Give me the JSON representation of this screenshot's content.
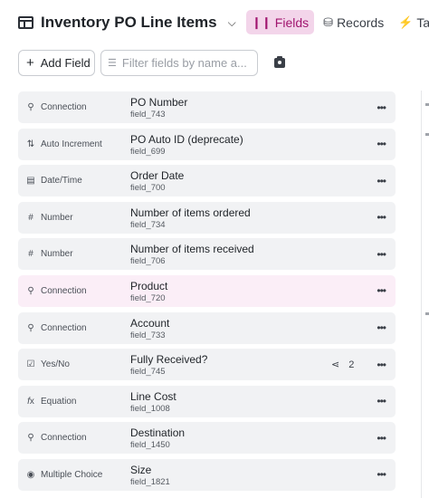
{
  "header": {
    "title": "Inventory PO Line Items",
    "tabs": [
      {
        "label": "Fields",
        "icon": "bars-icon",
        "active": true
      },
      {
        "label": "Records",
        "icon": "database-icon",
        "active": false
      },
      {
        "label": "Tasks",
        "icon": "bolt-icon",
        "active": false
      }
    ]
  },
  "toolbar": {
    "add_field_label": "Add Field",
    "filter_placeholder": "Filter fields by name a..."
  },
  "fields": [
    {
      "type": "Connection",
      "icon": "connection-icon",
      "name": "PO Number",
      "key": "field_743"
    },
    {
      "type": "Auto Increment",
      "icon": "auto-increment-icon",
      "name": "PO Auto ID (deprecate)",
      "key": "field_699"
    },
    {
      "type": "Date/Time",
      "icon": "calendar-icon",
      "name": "Order Date",
      "key": "field_700"
    },
    {
      "type": "Number",
      "icon": "hash-icon",
      "name": "Number of items ordered",
      "key": "field_734"
    },
    {
      "type": "Number",
      "icon": "hash-icon",
      "name": "Number of items received",
      "key": "field_706"
    },
    {
      "type": "Connection",
      "icon": "connection-icon",
      "name": "Product",
      "key": "field_720",
      "highlight": true
    },
    {
      "type": "Connection",
      "icon": "connection-icon",
      "name": "Account",
      "key": "field_733"
    },
    {
      "type": "Yes/No",
      "icon": "checkbox-icon",
      "name": "Fully Received?",
      "key": "field_745",
      "links": "2"
    },
    {
      "type": "Equation",
      "icon": "function-icon",
      "name": "Line Cost",
      "key": "field_1008"
    },
    {
      "type": "Connection",
      "icon": "connection-icon",
      "name": "Destination",
      "key": "field_1450"
    },
    {
      "type": "Multiple Choice",
      "icon": "radio-icon",
      "name": "Size",
      "key": "field_1821"
    }
  ],
  "colors": {
    "accent": "#a1156f",
    "active_tab_bg": "#f3d5ea",
    "row_bg": "#f1f2f4",
    "row_highlight_bg": "#fbeef7"
  }
}
